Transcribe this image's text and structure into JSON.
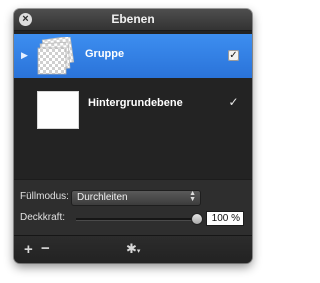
{
  "window": {
    "title": "Ebenen"
  },
  "layers": [
    {
      "name": "Gruppe",
      "visible": true,
      "selected": true
    },
    {
      "name": "Hintergrundebene",
      "visible": true,
      "selected": false
    }
  ],
  "blend": {
    "label": "Füllmodus:",
    "value": "Durchleiten"
  },
  "opacity": {
    "label": "Deckkraft:",
    "value": "100 %",
    "level": 1.0
  },
  "toolbar": {
    "add_icon": "plus-icon",
    "remove_icon": "minus-icon",
    "settings_icon": "gear-icon"
  },
  "colors": {
    "selection": "#2f7ee6",
    "panel": "#2b2b2b"
  }
}
